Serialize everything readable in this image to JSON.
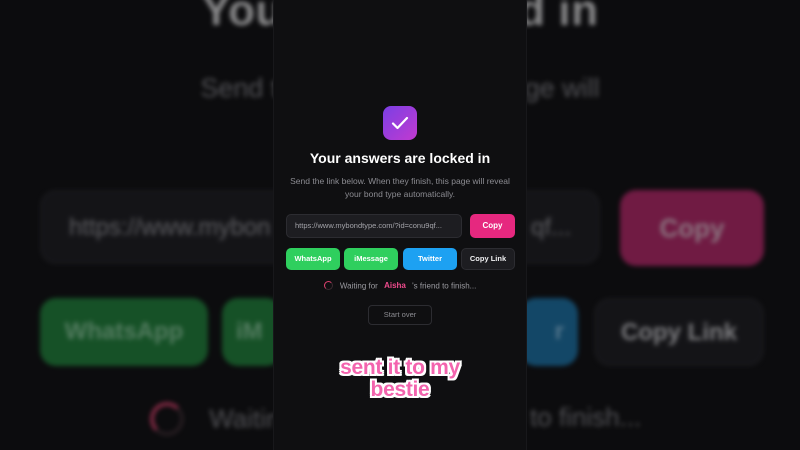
{
  "page": {
    "title": "Your answers are locked in",
    "subtitle": "Send the link below. When they finish, this page will reveal your bond type automatically.",
    "check_icon": "check-icon",
    "accent_color": "#e6287f"
  },
  "share": {
    "link": "https://www.mybondtype.com/?id=conu9qf...",
    "copy_label": "Copy",
    "buttons": {
      "whatsapp": "WhatsApp",
      "imessage": "iMessage",
      "twitter": "Twitter",
      "copy_link": "Copy Link"
    },
    "colors": {
      "whatsapp": "#2fcf5e",
      "imessage": "#2fcf5e",
      "twitter": "#1da1f2",
      "copy": "#e6287f"
    }
  },
  "status": {
    "prefix": "Waiting for",
    "name": "Aisha",
    "suffix": "'s friend to finish...",
    "spinner_icon": "spinner-icon"
  },
  "start_over_label": "Start over",
  "background": {
    "title": "Your ans         locked in",
    "subtitle_line1": "Send the link be          sh, this page will",
    "subtitle_line2": "reveal yo                        matically.",
    "link_left": "https://www.mybon",
    "link_right": "qf...",
    "copy": "Copy",
    "whatsapp": "WhatsApp",
    "imessage_partial": "iM",
    "twitter_partial": "r",
    "copy_link": "Copy Link",
    "wait_left": "Waitin",
    "wait_right": "to finish..."
  },
  "caption": {
    "line1": "sent it to my",
    "line2": "bestie"
  }
}
